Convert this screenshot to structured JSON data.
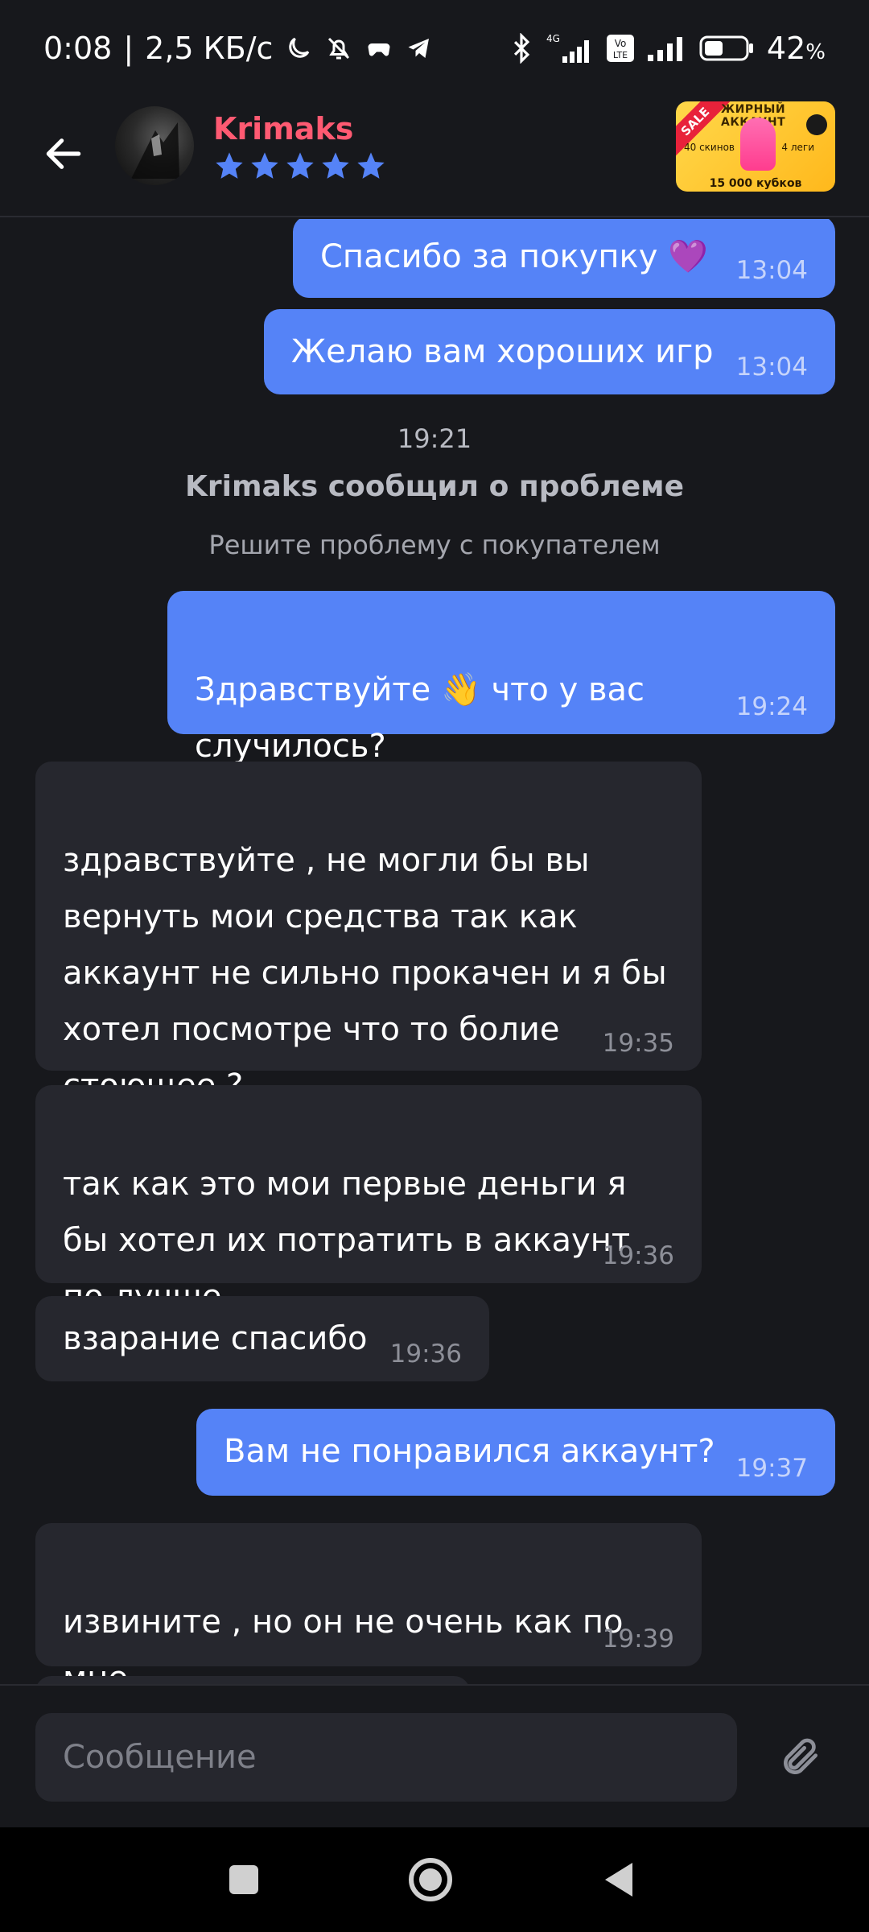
{
  "status_bar": {
    "time": "0:08",
    "speed": "2,5 КБ/с",
    "network": "4G",
    "volte": "Vo LTE",
    "battery": "42",
    "battery_unit": "%"
  },
  "header": {
    "user_name": "Krimaks",
    "rating_stars": 5,
    "lot": {
      "sale": "SALE",
      "title": "ЖИРНЫЙ АККАУНТ",
      "skins": "40 скинов",
      "legs": "4 леги",
      "cups": "15 000 кубков"
    }
  },
  "messages": [
    {
      "direction": "out",
      "text": "Спасибо за покупку 💜",
      "time": "13:04"
    },
    {
      "direction": "out",
      "text": "Желаю вам хороших игр",
      "time": "13:04"
    },
    {
      "direction": "out",
      "text": "Здравствуйте 👋 что у вас\nслучилось?",
      "time": "19:24"
    },
    {
      "direction": "in",
      "text": "здравствуйте , не могли бы вы\nвернуть мои средства так как\nаккаунт не сильно прокачен и я бы\nхотел посмотре что то болие\nстоющее ?",
      "time": "19:35"
    },
    {
      "direction": "in",
      "text": "так как это мои первые деньги я\nбы хотел их потратить в аккаунт\nпо лучше",
      "time": "19:36"
    },
    {
      "direction": "in",
      "text": "взарание спасибо",
      "time": "19:36"
    },
    {
      "direction": "out",
      "text": "Вам не понравился аккаунт?",
      "time": "19:37"
    },
    {
      "direction": "in",
      "text": "извините , но он не очень как по\nмне",
      "time": "19:39"
    }
  ],
  "system_event": {
    "time": "19:21",
    "title": "Krimaks сообщил о проблеме",
    "subtitle": "Решите проблему с покупателем"
  },
  "input": {
    "placeholder": "Сообщение"
  },
  "colors": {
    "background": "#17181c",
    "outgoing_bubble": "#5583f7",
    "incoming_bubble": "#26272e",
    "user_name": "#ff5a72",
    "star": "#5583f7"
  },
  "icons": [
    "back-arrow-icon",
    "star-icon",
    "paperclip-icon",
    "recents-square-icon",
    "home-circle-icon",
    "back-triangle-icon",
    "moon-icon",
    "bell-off-icon",
    "gamepad-icon",
    "telegram-icon",
    "bluetooth-icon",
    "signal-icon",
    "battery-icon"
  ]
}
